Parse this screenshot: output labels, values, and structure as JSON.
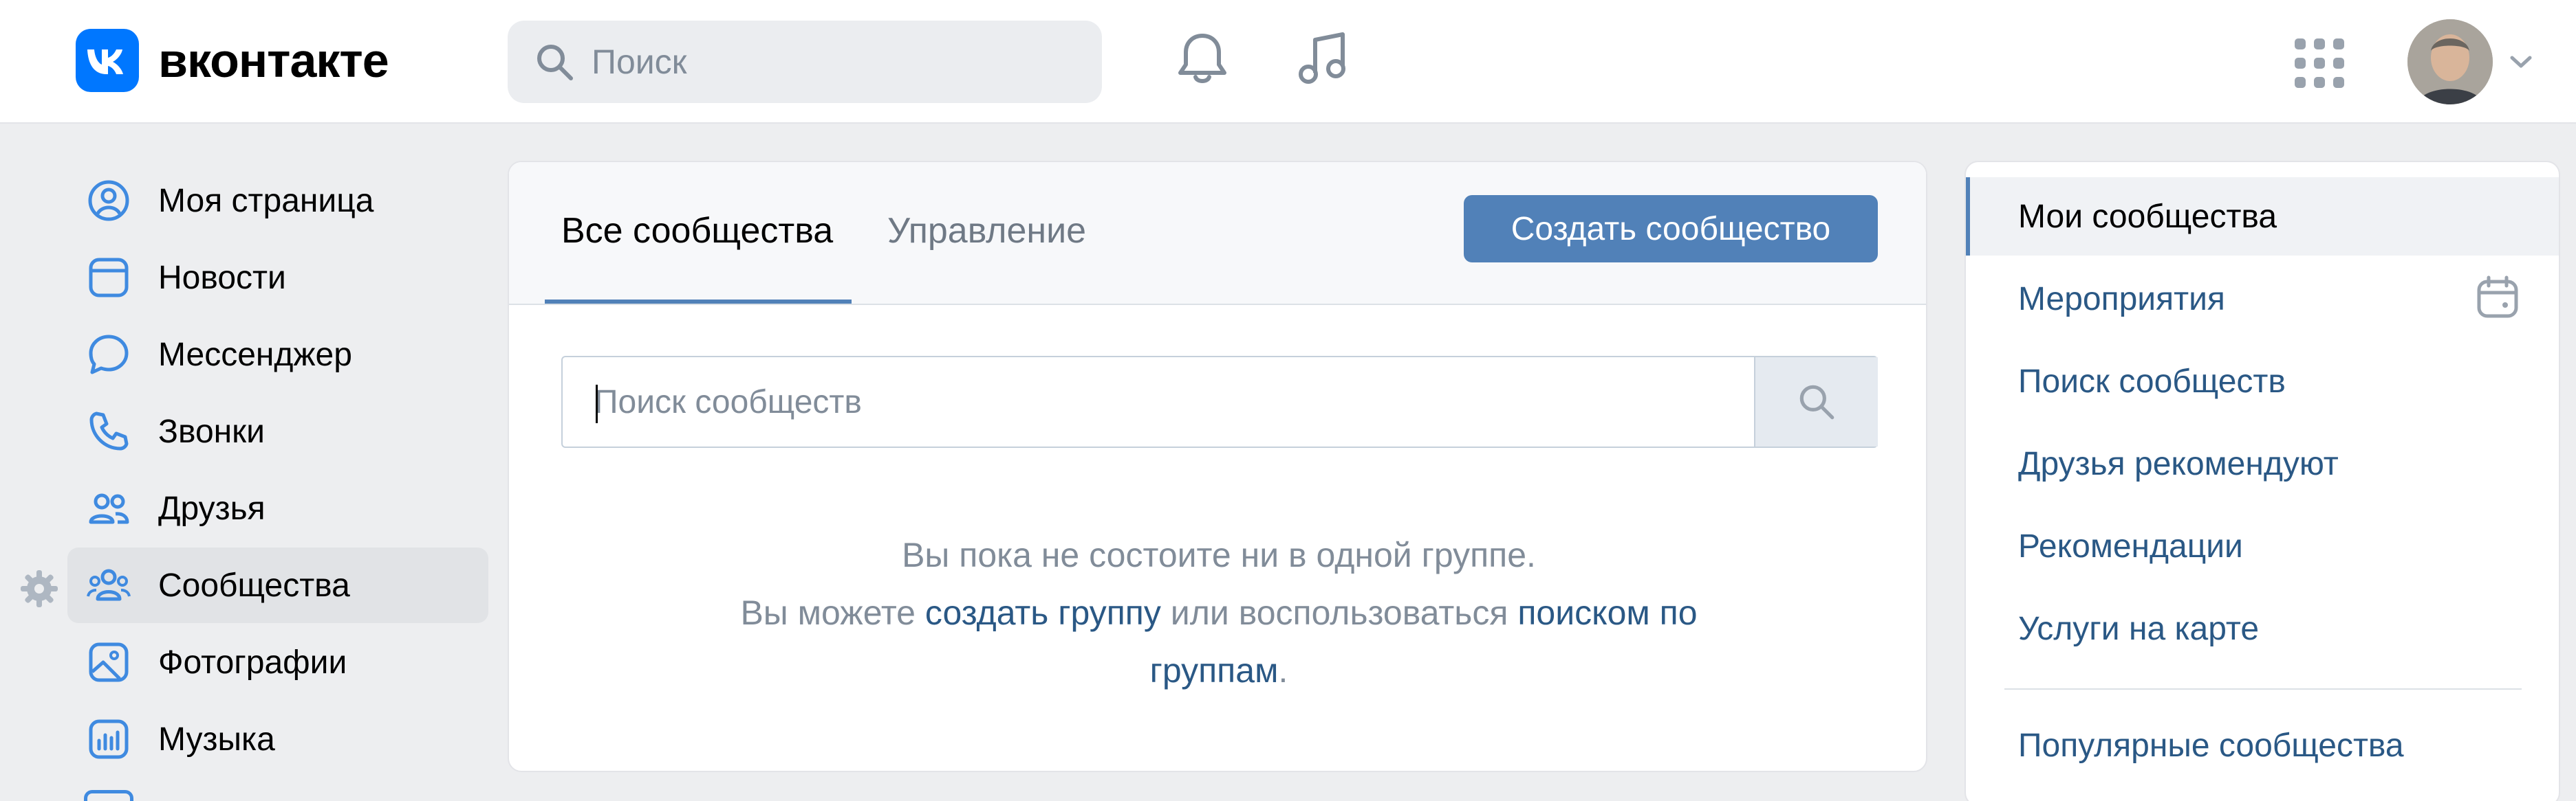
{
  "header": {
    "logo_text": "вконтакте",
    "search_placeholder": "Поиск",
    "icons": [
      "vk-logo-icon",
      "search-icon",
      "bell-icon",
      "music-icon",
      "apps-grid-icon",
      "avatar",
      "chevron-down-icon"
    ]
  },
  "sidebar": {
    "items": [
      {
        "label": "Моя страница",
        "icon": "user-circle-icon"
      },
      {
        "label": "Новости",
        "icon": "news-icon"
      },
      {
        "label": "Мессенджер",
        "icon": "message-icon"
      },
      {
        "label": "Звонки",
        "icon": "phone-icon"
      },
      {
        "label": "Друзья",
        "icon": "friends-icon"
      },
      {
        "label": "Сообщества",
        "icon": "communities-icon",
        "active": true
      },
      {
        "label": "Фотографии",
        "icon": "photo-icon"
      },
      {
        "label": "Музыка",
        "icon": "music-chart-icon"
      }
    ]
  },
  "main": {
    "tabs": [
      {
        "label": "Все сообщества",
        "active": true
      },
      {
        "label": "Управление",
        "active": false
      }
    ],
    "create_button": "Создать сообщество",
    "search_placeholder": "Поиск сообществ",
    "empty": {
      "line1": "Вы пока не состоите ни в одной группе.",
      "line2_prefix": "Вы можете ",
      "link_create": "создать группу",
      "line2_middle": " или воспользоваться ",
      "link_search_a": "поиском по",
      "link_search_b": "группам",
      "line3_suffix": "."
    }
  },
  "right_menu": {
    "items": [
      {
        "label": "Мои сообщества",
        "active": true
      },
      {
        "label": "Мероприятия",
        "icon": "calendar-icon"
      },
      {
        "label": "Поиск сообществ"
      },
      {
        "label": "Друзья рекомендуют"
      },
      {
        "label": "Рекомендации"
      },
      {
        "label": "Услуги на карте"
      },
      {
        "label": "Популярные сообщества"
      }
    ]
  },
  "colors": {
    "accent": "#5181b8",
    "vk_blue": "#0077ff",
    "link": "#2a5885",
    "icon_blue": "#3f8ae0",
    "background": "#edeef0"
  }
}
